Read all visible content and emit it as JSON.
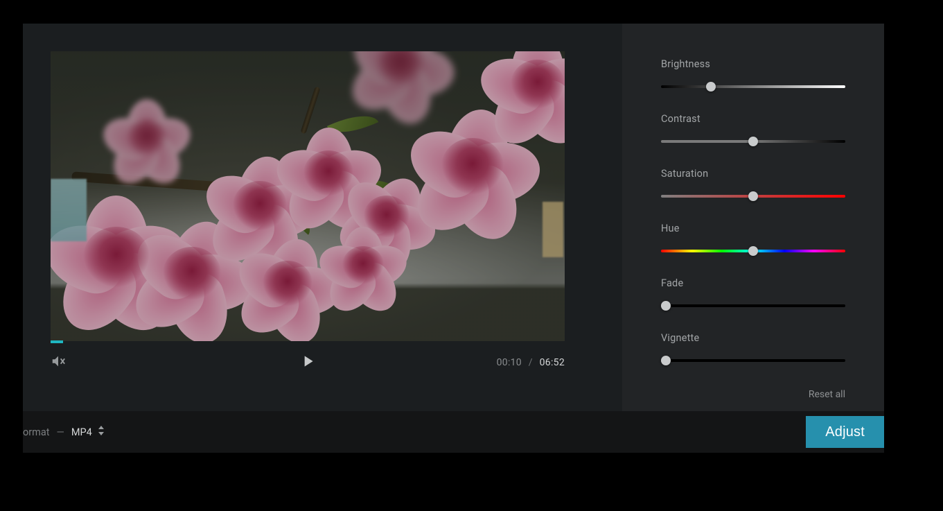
{
  "video": {
    "current_time": "00:10",
    "total_time": "06:52",
    "progress_percent": 2.4
  },
  "adjust": {
    "sliders": [
      {
        "label": "Brightness",
        "track_class": "track-brightness",
        "thumb_percent": 27
      },
      {
        "label": "Contrast",
        "track_class": "track-contrast",
        "thumb_percent": 50
      },
      {
        "label": "Saturation",
        "track_class": "track-saturation",
        "thumb_percent": 50
      },
      {
        "label": "Hue",
        "track_class": "track-hue",
        "thumb_percent": 50
      },
      {
        "label": "Fade",
        "track_class": "track-fade",
        "thumb_percent": 2.5
      },
      {
        "label": "Vignette",
        "track_class": "track-vignette",
        "thumb_percent": 2.5
      }
    ],
    "reset_label": "Reset all"
  },
  "bottom": {
    "format_prefix": "ormat",
    "format_dash": "—",
    "format_value": "MP4",
    "action_label": "Adjust"
  },
  "colors": {
    "accent": "#2690ad",
    "progress": "#1fb6c1"
  }
}
